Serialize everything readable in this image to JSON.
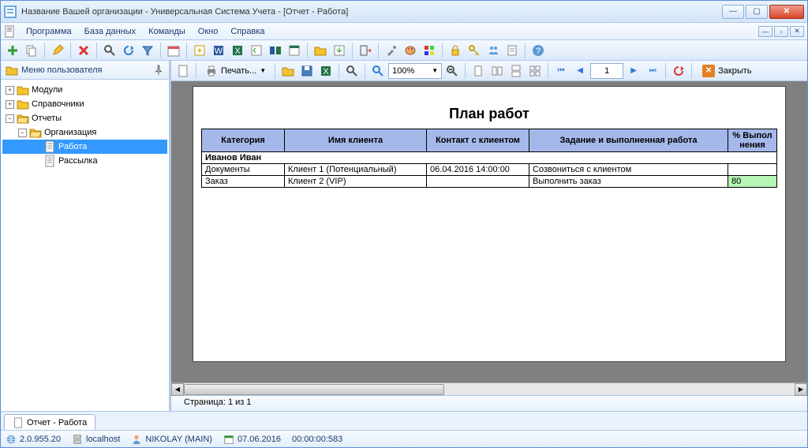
{
  "titlebar": {
    "title": "Название Вашей организации - Универсальная Система Учета - [Отчет - Работа]"
  },
  "menubar": {
    "items": [
      "Программа",
      "База данных",
      "Команды",
      "Окно",
      "Справка"
    ]
  },
  "sidebar": {
    "title": "Меню пользователя",
    "tree": {
      "modules": "Модули",
      "refs": "Справочники",
      "reports": "Отчеты",
      "org": "Организация",
      "work": "Работа",
      "mailing": "Рассылка"
    }
  },
  "report_toolbar": {
    "print": "Печать...",
    "zoom": "100%",
    "page": "1",
    "close": "Закрыть"
  },
  "report": {
    "title": "План работ",
    "headers": {
      "category": "Категория",
      "client": "Имя клиента",
      "contact": "Контакт с клиентом",
      "task": "Задание и выполненная работа",
      "pct": "% Выпол нения"
    },
    "group": "Иванов Иван",
    "rows": [
      {
        "category": "Документы",
        "client": "Клиент 1 (Потенциальный)",
        "contact": "06.04.2016 14:00:00",
        "task": "Созвониться с клиентом",
        "pct": ""
      },
      {
        "category": "Заказ",
        "client": "Клиент 2 (VIP)",
        "contact": "",
        "task": "Выполнить заказ",
        "pct": "80"
      }
    ]
  },
  "page_status": "Страница: 1 из 1",
  "tab": "Отчет - Работа",
  "statusbar": {
    "version": "2.0.955.20",
    "host": "localhost",
    "user": "NIKOLAY (MAIN)",
    "date": "07.06.2016",
    "time": "00:00:00:583"
  }
}
